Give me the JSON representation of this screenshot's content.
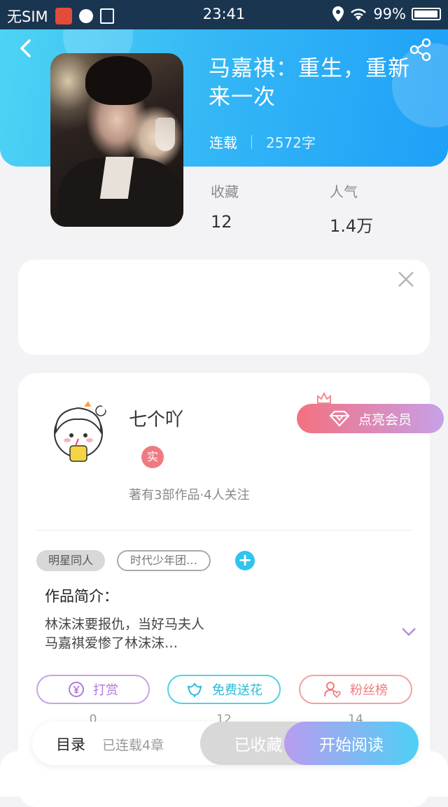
{
  "status_bar": {
    "carrier": "无SIM",
    "time": "23:41",
    "battery": "99%"
  },
  "book": {
    "title": "马嘉祺：重生，重新来一次",
    "status": "连载",
    "word_count": "2572字",
    "favorites_label": "收藏",
    "favorites_value": "12",
    "popularity_label": "人气",
    "popularity_value": "1.4万"
  },
  "author": {
    "name": "七个吖",
    "badge": "实",
    "stats": "著有3部作品·4人关注",
    "vip_button": "点亮会员"
  },
  "tags": [
    "明星同人",
    "时代少年团…"
  ],
  "intro": {
    "heading": "作品简介：",
    "text_line1": "林沫沫要报仇，当好马夫人",
    "text_line2": "马嘉祺爱惨了林沫沫…"
  },
  "actions": {
    "reward_label": "打赏",
    "reward_count": "0",
    "flower_label": "免费送花",
    "flower_count": "12",
    "fans_label": "粉丝榜",
    "fans_count": "14"
  },
  "bottom_bar": {
    "toc_label": "目录",
    "chapters": "已连载4章",
    "saved_label": "已收藏",
    "read_label": "开始阅读"
  },
  "colors": {
    "header_gradient_start": "#4dd4f4",
    "header_gradient_end": "#1ea0f8",
    "vip_gradient_start": "#f3717f",
    "vip_gradient_end": "#c7a0e8",
    "read_gradient_start": "#b99cf0",
    "read_gradient_end": "#4ed0f5"
  },
  "icons": [
    "back-icon",
    "share-icon",
    "close-icon",
    "diamond-icon",
    "crown-icon",
    "plus-icon",
    "chevron-down-icon",
    "yen-coin-icon",
    "flower-icon",
    "person-heart-icon"
  ]
}
